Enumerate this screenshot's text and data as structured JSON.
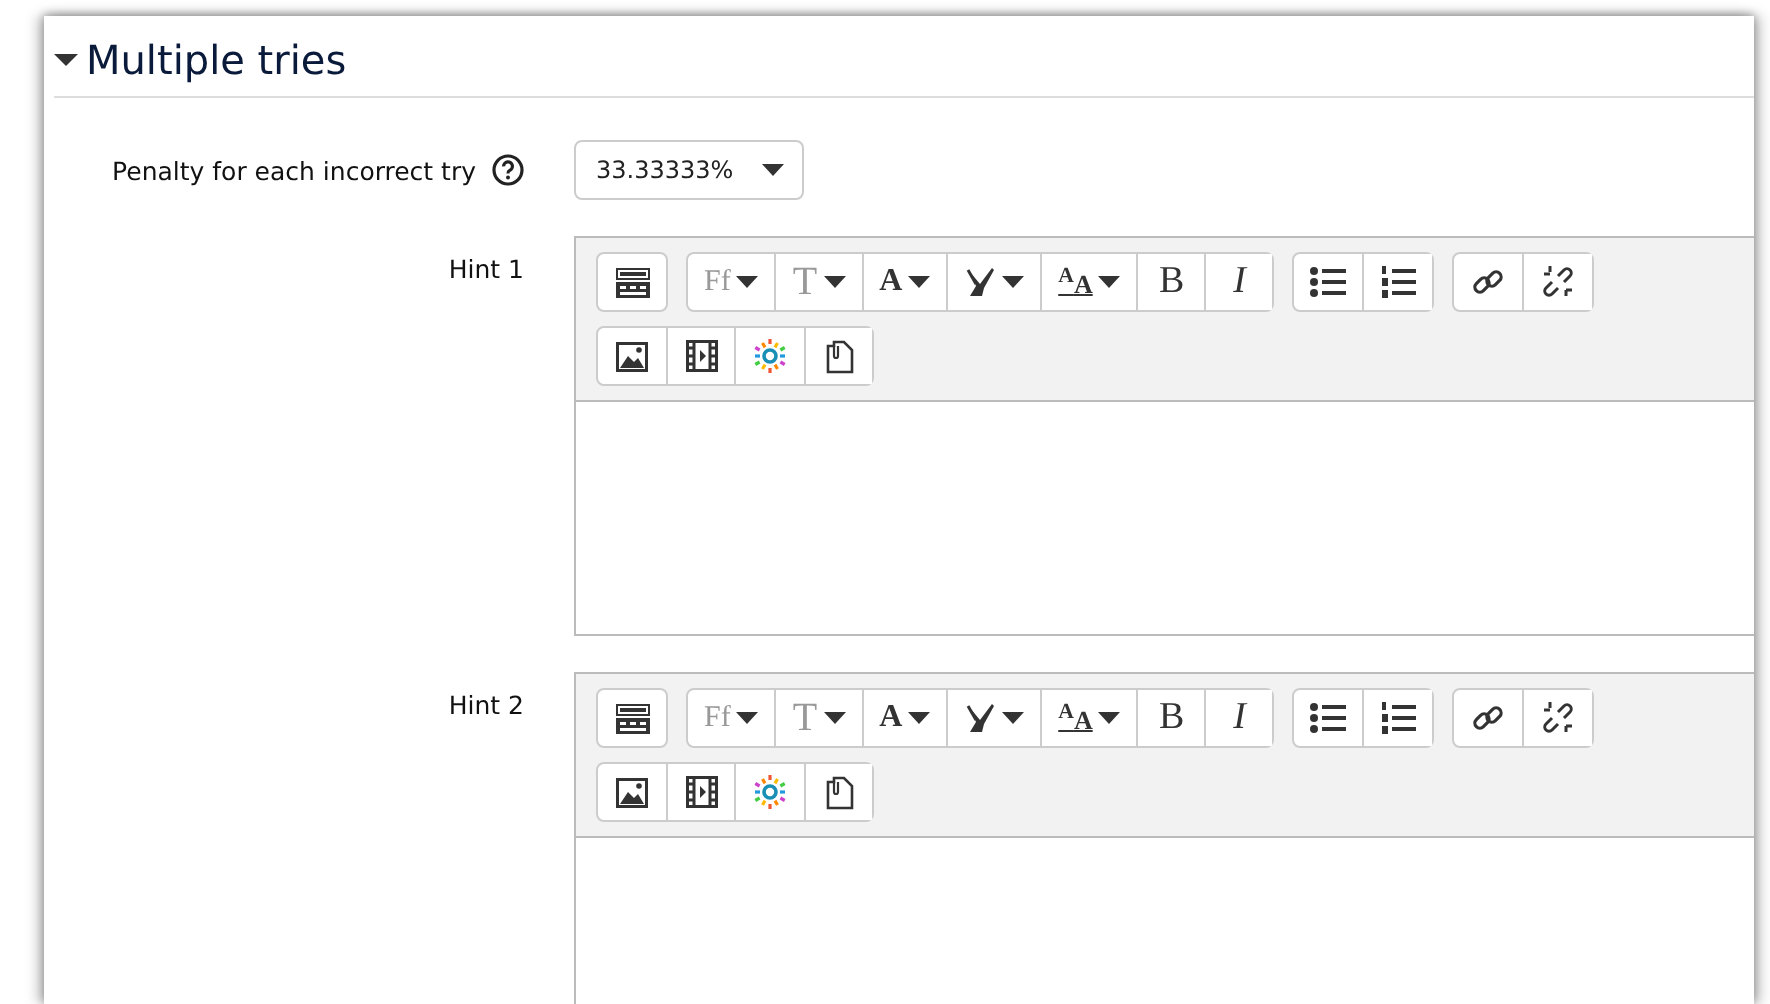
{
  "section": {
    "title": "Multiple tries",
    "expanded": true
  },
  "penalty": {
    "label": "Penalty for each incorrect try",
    "value": "33.33333%"
  },
  "hints": [
    {
      "label": "Hint 1",
      "toolbar": [
        [
          {
            "kind": "collapse"
          }
        ],
        [
          {
            "kind": "font",
            "label": "Ff",
            "dropdown": true
          },
          {
            "kind": "size",
            "label": "T",
            "dropdown": true
          },
          {
            "kind": "fontcolor",
            "label": "A",
            "dropdown": true
          },
          {
            "kind": "backcolor",
            "dropdown": true
          },
          {
            "kind": "styles",
            "label": "$^{A}$A",
            "dropdown": true
          },
          {
            "kind": "bold",
            "label": "B"
          },
          {
            "kind": "italic",
            "label": "I"
          }
        ],
        [
          {
            "kind": "bullets"
          },
          {
            "kind": "numbers"
          }
        ],
        [
          {
            "kind": "link"
          },
          {
            "kind": "unlink"
          }
        ]
      ],
      "toolbar2": [
        [
          {
            "kind": "image"
          },
          {
            "kind": "media"
          },
          {
            "kind": "manage"
          },
          {
            "kind": "files"
          }
        ]
      ]
    },
    {
      "label": "Hint 2",
      "toolbar": [
        [
          {
            "kind": "collapse"
          }
        ],
        [
          {
            "kind": "font",
            "label": "Ff",
            "dropdown": true
          },
          {
            "kind": "size",
            "label": "T",
            "dropdown": true
          },
          {
            "kind": "fontcolor",
            "label": "A",
            "dropdown": true
          },
          {
            "kind": "backcolor",
            "dropdown": true
          },
          {
            "kind": "styles",
            "label": "$^{A}$A",
            "dropdown": true
          },
          {
            "kind": "bold",
            "label": "B"
          },
          {
            "kind": "italic",
            "label": "I"
          }
        ],
        [
          {
            "kind": "bullets"
          },
          {
            "kind": "numbers"
          }
        ],
        [
          {
            "kind": "link"
          },
          {
            "kind": "unlink"
          }
        ]
      ],
      "toolbar2": [
        [
          {
            "kind": "image"
          },
          {
            "kind": "media"
          },
          {
            "kind": "manage"
          },
          {
            "kind": "files"
          }
        ]
      ]
    }
  ]
}
